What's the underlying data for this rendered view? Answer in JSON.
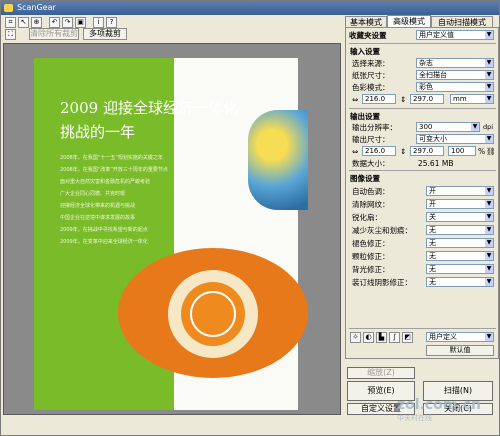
{
  "window": {
    "title": "ScanGear"
  },
  "toolbar": {
    "icons": [
      "crop-icon",
      "select-icon",
      "zoom-icon",
      "rotate-left-icon",
      "rotate-right-icon",
      "auto-crop-icon",
      "info-icon",
      "help-icon"
    ],
    "clear_all_label": "清除所有裁剪",
    "multi_crop_label": "多项裁剪"
  },
  "preview": {
    "headline_line1": "2009 迎接全球经济一体化",
    "headline_line2": "挑战的一年",
    "body_lines": [
      "2008年，在我国“十一五”规划实施的关键之年",
      "2008年，在我国“改革”开放三十周年的重要节点",
      "面对重大自然灾害和金融危机的严峻考验",
      "广大企业同心同德、共克时艰",
      "迎接经济全球化带来的机遇与挑战",
      "中国企业在逆境中谋求发展的故事",
      "2009年，在挑战中寻找希望与新的起点",
      "2009年，在变革中迎来全球经济一体化"
    ]
  },
  "tabs": [
    {
      "label": "基本模式",
      "active": false
    },
    {
      "label": "高级模式",
      "active": true
    },
    {
      "label": "自动扫描模式",
      "active": false
    }
  ],
  "favorites": {
    "label": "收藏夹设置",
    "value": "用户定义值"
  },
  "input_settings": {
    "header": "输入设置",
    "source_label": "选择来源：",
    "source_value": "杂志",
    "paper_label": "纸张尺寸：",
    "paper_value": "全扫描台",
    "color_label": "色彩模式：",
    "color_value": "彩色",
    "width": "216.0",
    "height": "297.0",
    "unit": "mm"
  },
  "output_settings": {
    "header": "输出设置",
    "resolution_label": "输出分辨率：",
    "resolution_value": "300",
    "resolution_unit": "dpi",
    "size_label": "输出尺寸：",
    "size_value": "可变大小",
    "width": "216.0",
    "height": "297.0",
    "scale": "100",
    "scale_unit": "%",
    "datasize_label": "数据大小：",
    "datasize_value": "25.61 MB"
  },
  "image_settings": {
    "header": "图像设置",
    "rows": [
      {
        "label": "自动色调：",
        "value": "开"
      },
      {
        "label": "清除网纹：",
        "value": "开"
      },
      {
        "label": "锐化扇：",
        "value": "关"
      },
      {
        "label": "减少灰尘和划痕：",
        "value": "无"
      },
      {
        "label": "褪色修正：",
        "value": "无"
      },
      {
        "label": "颗粒修正：",
        "value": "无"
      },
      {
        "label": "背光修正：",
        "value": "无"
      },
      {
        "label": "装订线阴影修正：",
        "value": "无"
      }
    ]
  },
  "adjust": {
    "icons": [
      "brightness-icon",
      "contrast-icon",
      "histogram-icon",
      "tone-curve-icon",
      "threshold-icon"
    ],
    "preset_value": "用户定义",
    "defaults_label": "默认值"
  },
  "buttons": {
    "zoom_label": "缩放(Z)",
    "preview_label": "预览(E)",
    "scan_label": "扫描(N)",
    "prefs_label": "自定义设置",
    "close_label": "关闭(C)"
  },
  "watermark": {
    "domain": "zol.com.cn",
    "site": "中关村在线"
  }
}
